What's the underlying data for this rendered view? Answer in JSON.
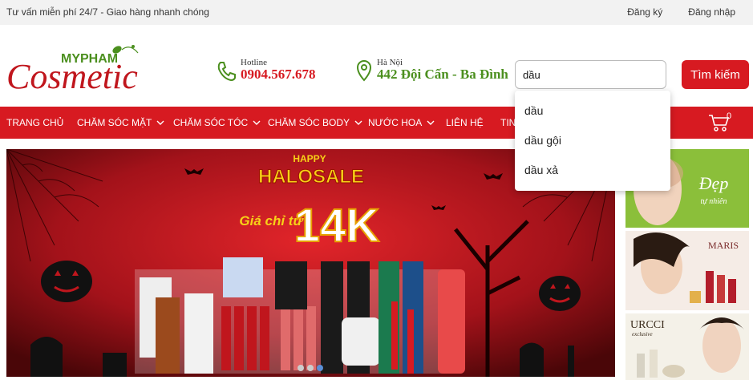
{
  "topbar": {
    "note": "Tư vấn miễn phí 24/7 - Giao hàng nhanh chóng",
    "register": "Đăng ký",
    "login": "Đăng nhập"
  },
  "logo": {
    "brand_top": "MYPHAM",
    "brand_main": "Cosmetic"
  },
  "hotline": {
    "label": "Hotline",
    "value": "0904.567.678"
  },
  "address": {
    "label": "Hà Nội",
    "value": "442 Đội Cấn - Ba Đình"
  },
  "search": {
    "value": "dầu",
    "button": "Tìm kiếm"
  },
  "nav": {
    "items": [
      "TRANG CHỦ",
      "CHĂM SÓC MẶT",
      "CHĂM SÓC TÓC",
      "CHĂM SÓC BODY",
      "NƯỚC HOA",
      "LIÊN HỆ",
      "TIN"
    ],
    "cart_count": "0"
  },
  "suggestions": [
    "dầu",
    "dầu gội",
    "dầu xả"
  ],
  "banner": {
    "happy": "HAPPY",
    "halo": "HALOSALE",
    "price_prefix": "Giá chỉ từ",
    "price": "14K"
  },
  "side_banners": {
    "s1": "Đẹp",
    "s1_sub": "tự nhiên",
    "s2": "MARIS",
    "s3": "URCCI",
    "s3_sub": "exclusive"
  },
  "colors": {
    "accent": "#d71a21",
    "green": "#4b8f1e",
    "topbar": "#f2f2f2"
  }
}
